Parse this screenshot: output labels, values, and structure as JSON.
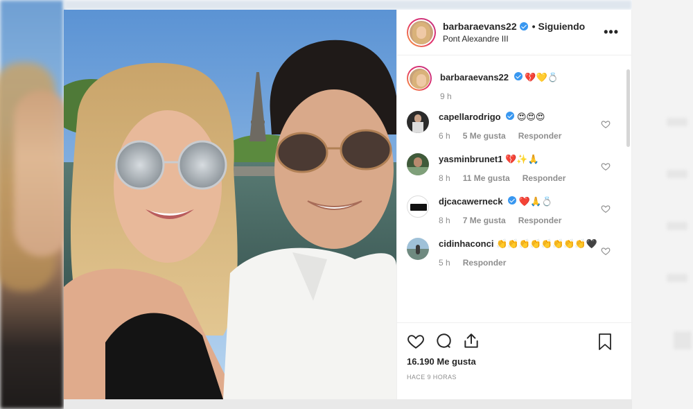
{
  "post": {
    "username": "barbaraevans22",
    "separator": "•",
    "follow_status": "Siguiendo",
    "location": "Pont Alexandre III",
    "more_icon": "more-options-icon"
  },
  "caption": {
    "username": "barbaraevans22",
    "text": "💔💛💍",
    "time": "9 h"
  },
  "comments": [
    {
      "username": "capellarodrigo",
      "verified": true,
      "text": "😍😍😍",
      "time": "6 h",
      "likes": "5 Me gusta",
      "reply": "Responder"
    },
    {
      "username": "yasminbrunet1",
      "verified": false,
      "text": "💔✨🙏",
      "time": "8 h",
      "likes": "11 Me gusta",
      "reply": "Responder"
    },
    {
      "username": "djcacawerneck",
      "verified": true,
      "text": "❤️🙏💍",
      "time": "8 h",
      "likes": "7 Me gusta",
      "reply": "Responder"
    },
    {
      "username": "cidinhaconci",
      "verified": false,
      "text": "👏👏👏👏👏👏👏👏🖤",
      "time": "5 h",
      "likes": "",
      "reply": "Responder"
    }
  ],
  "actions": {
    "likes_count": "16.190 Me gusta",
    "posted_ago": "HACE 9 HORAS"
  },
  "colors": {
    "text": "#262626",
    "secondary": "#8e8e8e",
    "verified": "#3897f0",
    "border": "#efefef"
  }
}
